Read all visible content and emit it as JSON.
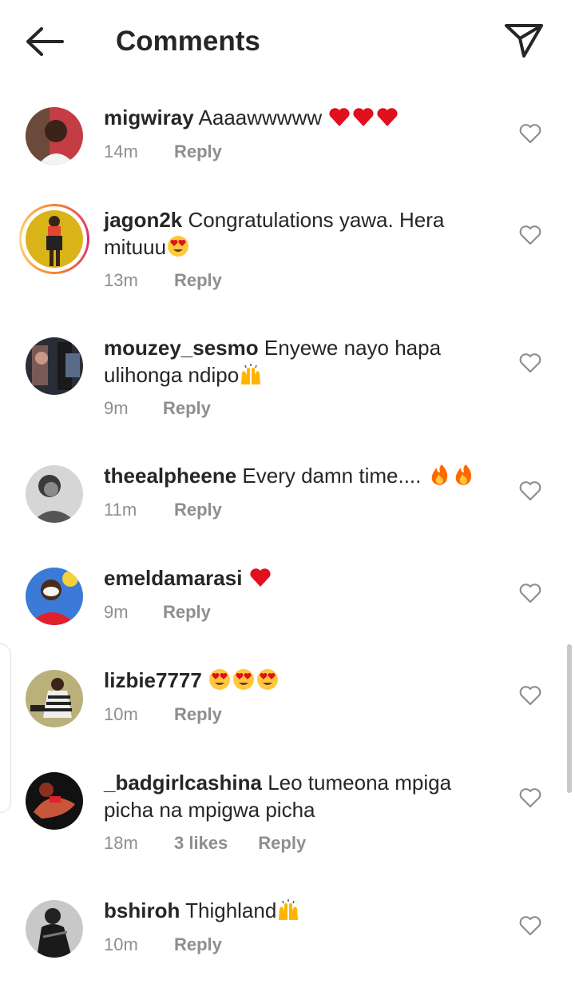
{
  "header": {
    "title": "Comments",
    "back_icon": "back-arrow-icon",
    "send_icon": "paper-plane-icon"
  },
  "comments": [
    {
      "username": "migwiray",
      "text": "Aaaawwwww",
      "emojis": [
        "heart",
        "heart",
        "heart"
      ],
      "time": "14m",
      "likes": "",
      "reply_label": "Reply",
      "story_ring": false
    },
    {
      "username": "jagon2k",
      "text": "Congratulations yawa. Hera mituuu",
      "emojis": [
        "heart-eyes"
      ],
      "time": "13m",
      "likes": "",
      "reply_label": "Reply",
      "story_ring": true
    },
    {
      "username": "mouzey_sesmo",
      "text": "Enyewe nayo hapa ulihonga ndipo",
      "emojis": [
        "raised-hands"
      ],
      "time": "9m",
      "likes": "",
      "reply_label": "Reply",
      "story_ring": false
    },
    {
      "username": "theealpheene",
      "text": "Every damn time.... ",
      "emojis": [
        "fire",
        "fire"
      ],
      "time": "11m",
      "likes": "",
      "reply_label": "Reply",
      "story_ring": false
    },
    {
      "username": "emeldamarasi",
      "text": "",
      "emojis": [
        "heart"
      ],
      "time": "9m",
      "likes": "",
      "reply_label": "Reply",
      "story_ring": false
    },
    {
      "username": "lizbie7777",
      "text": "",
      "emojis": [
        "heart-eyes",
        "heart-eyes",
        "heart-eyes"
      ],
      "time": "10m",
      "likes": "",
      "reply_label": "Reply",
      "story_ring": false
    },
    {
      "username": "_badgirlcashina",
      "text": "Leo tumeona mpiga picha na mpigwa picha",
      "emojis": [],
      "time": "18m",
      "likes": "3 likes",
      "reply_label": "Reply",
      "story_ring": false
    },
    {
      "username": "bshiroh",
      "text": "Thighland",
      "emojis": [
        "raised-hands"
      ],
      "time": "10m",
      "likes": "",
      "reply_label": "Reply",
      "story_ring": false
    }
  ],
  "colors": {
    "text": "#262626",
    "meta": "#8e8e8e",
    "heart_emoji": "#e0101f"
  }
}
